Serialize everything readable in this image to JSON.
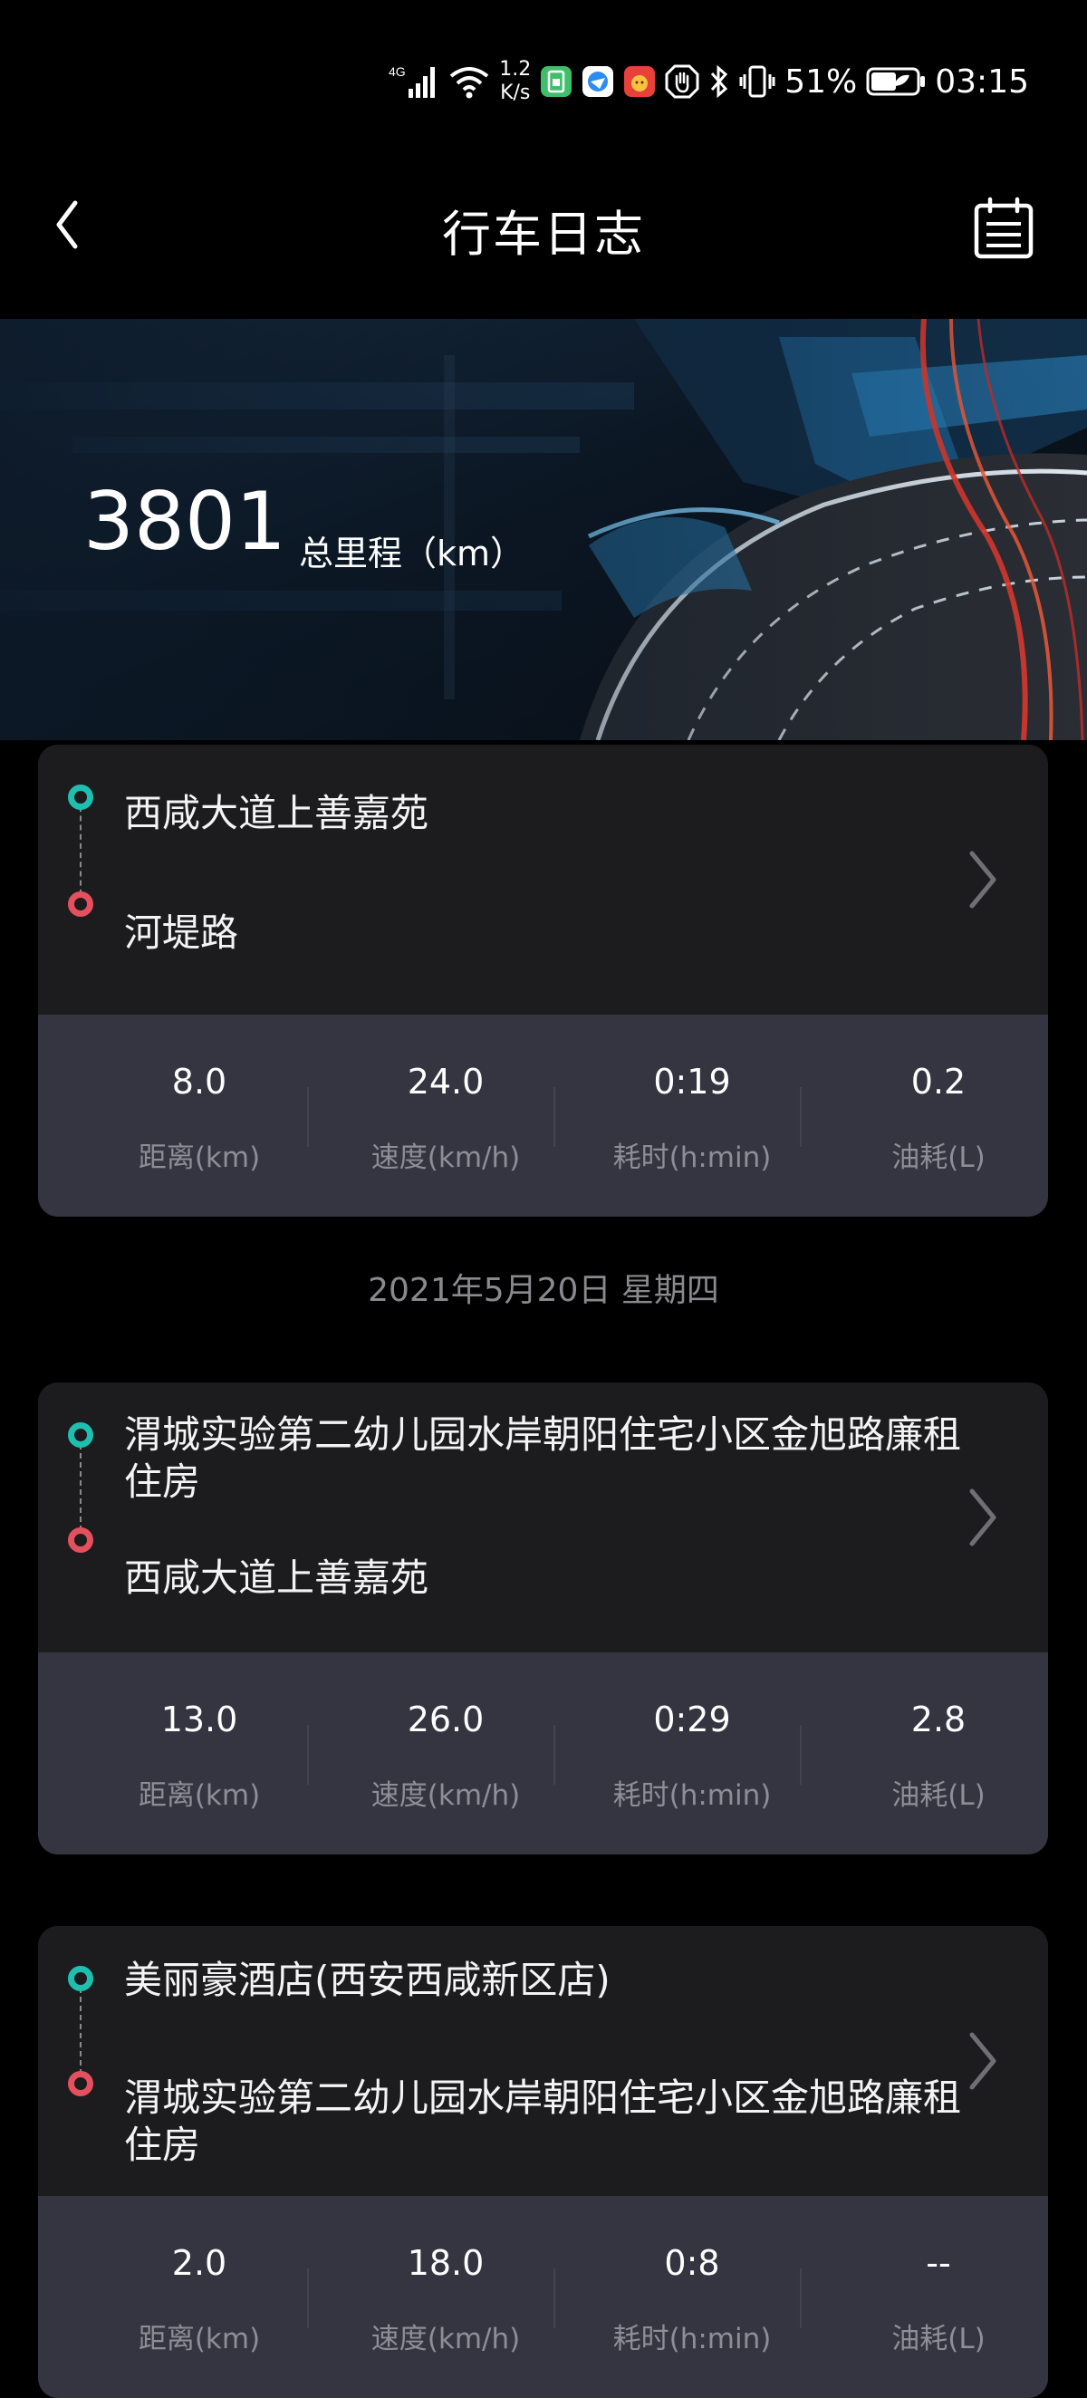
{
  "status_bar": {
    "network": "4G",
    "speed_value": "1.2",
    "speed_unit": "K/s",
    "battery": "51%",
    "time": "03:15",
    "icons": [
      "signal-icon",
      "wifi-icon",
      "sim-app-icon",
      "browser-app-icon",
      "game-app-icon",
      "hand-icon",
      "bluetooth-icon",
      "vibrate-icon",
      "battery-icon"
    ]
  },
  "header": {
    "title": "行车日志",
    "back_icon": "back-icon",
    "calendar_icon": "calendar-icon"
  },
  "banner": {
    "total_mileage": "3801",
    "total_mileage_label": "总里程（km）"
  },
  "stat_labels": [
    "距离(km)",
    "速度(km/h)",
    "耗时(h:min)",
    "油耗(L)"
  ],
  "date_header": "2021年5月20日 星期四",
  "trips": [
    {
      "start": "西咸大道上善嘉苑",
      "end": "河堤路",
      "stats": {
        "distance": "8.0",
        "speed": "24.0",
        "duration": "0:19",
        "fuel": "0.2"
      }
    },
    {
      "start": "渭城实验第二幼儿园水岸朝阳住宅小区金旭路廉租住房",
      "end": "西咸大道上善嘉苑",
      "stats": {
        "distance": "13.0",
        "speed": "26.0",
        "duration": "0:29",
        "fuel": "2.8"
      }
    },
    {
      "start": "美丽豪酒店(西安西咸新区店)",
      "end": "渭城实验第二幼儿园水岸朝阳住宅小区金旭路廉租住房",
      "stats": {
        "distance": "2.0",
        "speed": "18.0",
        "duration": "0:8",
        "fuel": "--"
      }
    }
  ],
  "colors": {
    "background": "#000000",
    "card": "#1c1c1e",
    "stats_panel": "#353541",
    "start_dot": "#1fbfb0",
    "end_dot": "#e5505e"
  }
}
